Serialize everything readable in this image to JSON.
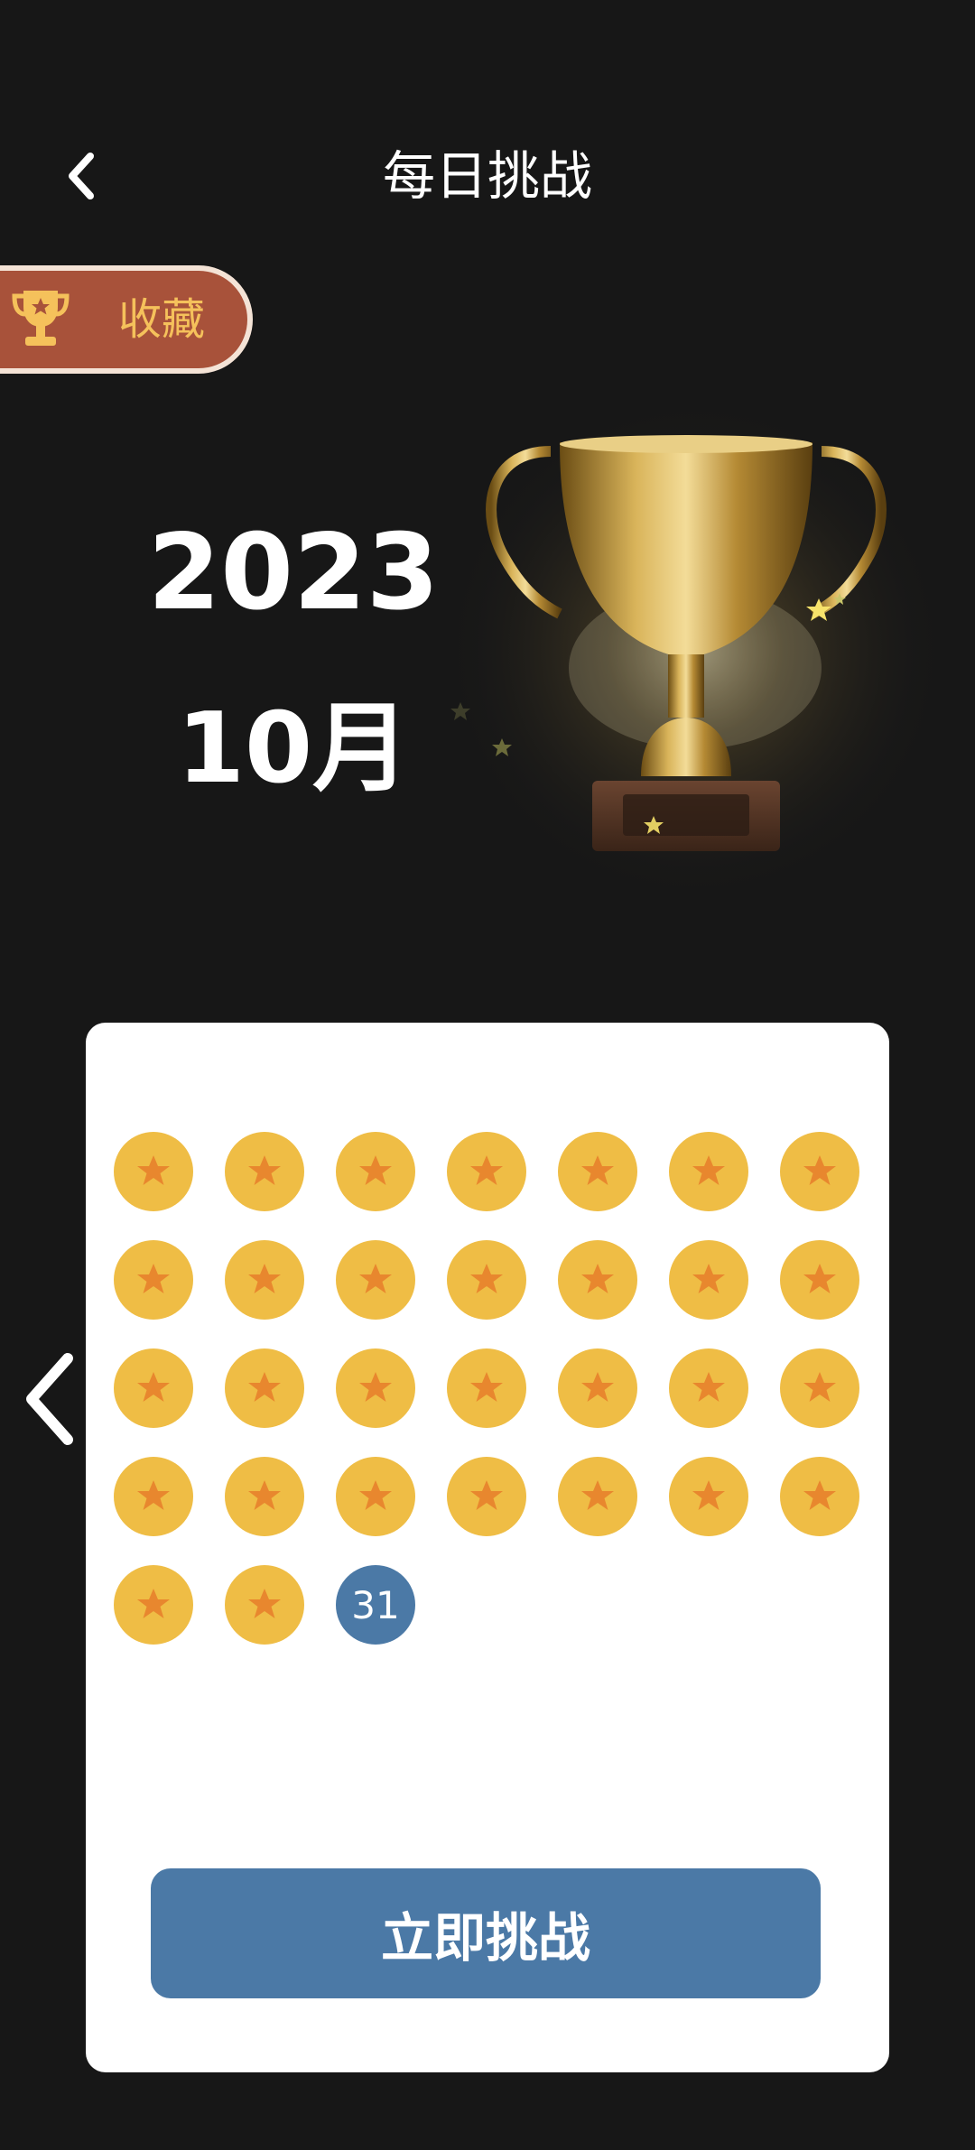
{
  "header": {
    "title": "每日挑战",
    "back_icon": "chevron-left-icon"
  },
  "collect": {
    "label": "收藏",
    "icon": "trophy-icon",
    "background_color": "#a8523a",
    "label_color": "#f5c15b"
  },
  "period": {
    "year": "2023",
    "month": "10月"
  },
  "calendar": {
    "completed_days": 30,
    "today_label": "31",
    "completed_icon": "star-icon",
    "completed_color": "#efbd45",
    "star_color": "#e8872e",
    "today_color": "#4b79a6"
  },
  "nav": {
    "prev_icon": "chevron-left-icon"
  },
  "action": {
    "challenge_label": "立即挑战",
    "button_color": "#4b79a6"
  }
}
